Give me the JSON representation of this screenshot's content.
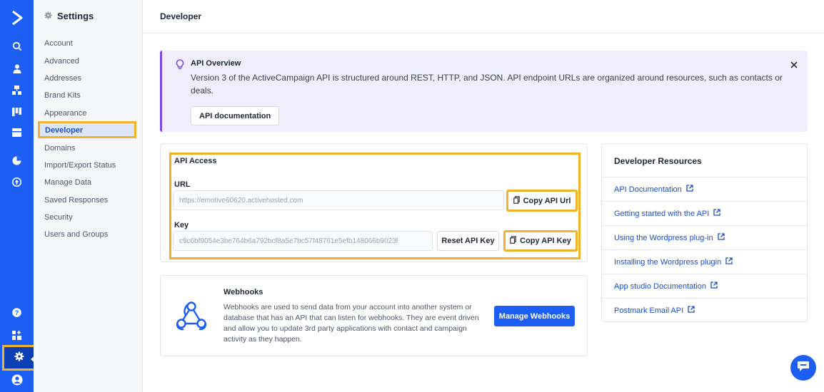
{
  "colors": {
    "brand": "#1d5ef5",
    "highlight": "#f1b32b",
    "banner_bg": "#f0eefd",
    "banner_accent": "#7b4ce0"
  },
  "rail": {
    "icons": [
      "logo-icon",
      "search-icon",
      "contacts-icon",
      "org-icon",
      "pipeline-icon",
      "campaigns-icon",
      "reports-icon",
      "automations-icon",
      "help-icon",
      "apps-icon",
      "settings-icon",
      "profile-icon"
    ]
  },
  "sidebar": {
    "title": "Settings",
    "items": [
      {
        "label": "Account"
      },
      {
        "label": "Advanced"
      },
      {
        "label": "Addresses"
      },
      {
        "label": "Brand Kits"
      },
      {
        "label": "Appearance"
      },
      {
        "label": "Developer",
        "active": true
      },
      {
        "label": "Domains"
      },
      {
        "label": "Import/Export Status"
      },
      {
        "label": "Manage Data"
      },
      {
        "label": "Saved Responses"
      },
      {
        "label": "Security"
      },
      {
        "label": "Users and Groups"
      }
    ]
  },
  "header": {
    "title": "Developer"
  },
  "banner": {
    "title": "API Overview",
    "description": "Version 3 of the ActiveCampaign API is structured around REST, HTTP, and JSON. API endpoint URLs are organized around resources, such as contacts or deals.",
    "button": "API documentation"
  },
  "api_access": {
    "title": "API Access",
    "url_label": "URL",
    "url_value": "https://emotive60620.activehosted.com",
    "copy_url": "Copy API Url",
    "key_label": "Key",
    "key_value": "c9c6bf9054e3be764b6a792bcf8a5e7bc57f48761e5efb148066b9023f",
    "reset_key": "Reset API Key",
    "copy_key": "Copy API Key"
  },
  "webhooks": {
    "title": "Webhooks",
    "description": "Webhooks are used to send data from your account into another system or database that has an API that can listen for webhooks. They are event driven and allow you to update 3rd party applications with contact and campaign activity as they happen.",
    "button": "Manage Webhooks"
  },
  "resources": {
    "title": "Developer Resources",
    "links": [
      {
        "label": "API Documentation"
      },
      {
        "label": "Getting started with the API"
      },
      {
        "label": "Using the Wordpress plug-in"
      },
      {
        "label": "Installing the Wordpress plugin"
      },
      {
        "label": "App studio Documentation"
      },
      {
        "label": "Postmark Email API"
      }
    ]
  }
}
